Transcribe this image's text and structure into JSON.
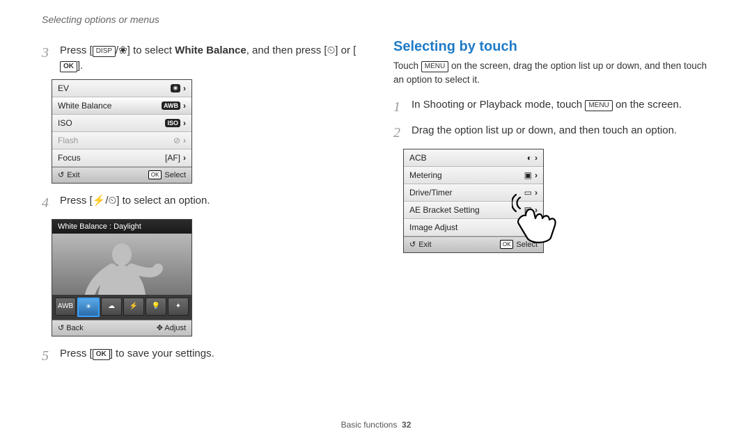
{
  "running_head": "Selecting options or menus",
  "left": {
    "step3": {
      "num": "3",
      "prefix": "Press [",
      "disp": "DISP",
      "mid": "] to select ",
      "bold": "White Balance",
      "suffix1": ", and then press [",
      "suffix2": "] or [",
      "ok": "OK",
      "suffix3": "]."
    },
    "menu": {
      "rows": [
        {
          "label": "EV",
          "icon": "☀",
          "dim": false
        },
        {
          "label": "White Balance",
          "icon": "AWB",
          "dim": false,
          "sel": true
        },
        {
          "label": "ISO",
          "icon": "ISO",
          "dim": false
        },
        {
          "label": "Flash",
          "icon": "⊘",
          "dim": true
        },
        {
          "label": "Focus",
          "icon": "[AF]",
          "dim": false
        }
      ],
      "exit": "Exit",
      "select": "Select",
      "ok": "OK"
    },
    "step4": {
      "num": "4",
      "prefix": "Press [",
      "mid": "] to select an option."
    },
    "wb": {
      "title": "White Balance : Daylight",
      "back": "Back",
      "adjust": "Adjust",
      "options": [
        "AWB",
        "☀",
        "☁",
        "⚡",
        "💡",
        "✦"
      ]
    },
    "step5": {
      "num": "5",
      "prefix": "Press [",
      "ok": "OK",
      "suffix": "] to save your settings."
    }
  },
  "right": {
    "heading": "Selecting by touch",
    "intro_a": "Touch ",
    "menu_label": "MENU",
    "intro_b": " on the screen, drag the option list up or down, and then touch an option to select it.",
    "step1": {
      "num": "1",
      "a": "In Shooting or Playback mode, touch ",
      "b": " on the screen."
    },
    "step2": {
      "num": "2",
      "text": "Drag the option list up or down, and then touch an option."
    },
    "menu": {
      "rows": [
        {
          "label": "ACB",
          "icon": "◐"
        },
        {
          "label": "Metering",
          "icon": "▣"
        },
        {
          "label": "Drive/Timer",
          "icon": "▭"
        },
        {
          "label": "AE Bracket Setting",
          "icon": "▤"
        },
        {
          "label": "Image Adjust",
          "icon": "✦"
        }
      ],
      "exit": "Exit",
      "select": "Select",
      "ok": "OK"
    }
  },
  "footer": {
    "section": "Basic functions",
    "page": "32"
  }
}
